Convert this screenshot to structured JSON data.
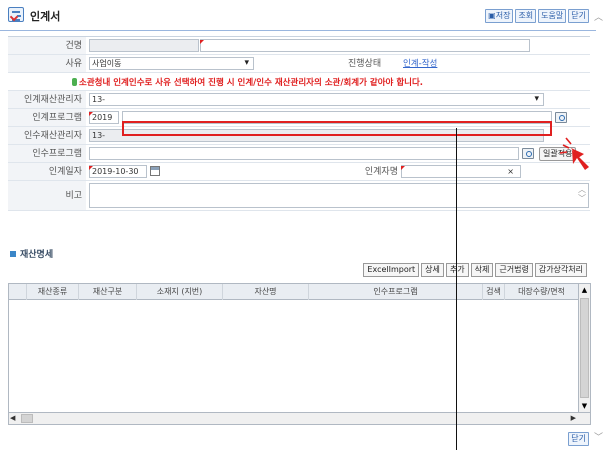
{
  "window": {
    "title": "인계서",
    "buttons": [
      {
        "label": "▣저장"
      },
      {
        "label": "조회"
      },
      {
        "label": "도움말"
      },
      {
        "label": "닫기"
      }
    ]
  },
  "form": {
    "name_label": "건명",
    "name_value": "",
    "reason_label": "사유",
    "reason_value": "사업이동",
    "status_label": "진행상태",
    "status_value": "인계-작성",
    "warning": "소관청내 인계인수로 사유 선택하여 진행 시 인계/인수 재산관리자의 소관/회계가 같아야 합니다.",
    "handover_manager_label": "인계재산관리자",
    "handover_manager_value": "13-",
    "handover_program_label": "인계프로그램",
    "handover_program_year": "2019",
    "handover_program_value": "",
    "takeover_manager_label": "인수재산관리자",
    "takeover_manager_value": "13-",
    "takeover_program_label": "인수프로그램",
    "takeover_program_value": "",
    "batch_apply_label": "일괄적용",
    "handover_date_label": "인계일자",
    "handover_date_value": "2019-10-30",
    "handover_person_label": "인계자명",
    "handover_person_value": "",
    "clear_glyph": "×",
    "remarks_label": "비고",
    "remarks_value": ""
  },
  "details": {
    "section_title": "재산명세",
    "buttons": [
      {
        "label": "ExcelImport"
      },
      {
        "label": "상세"
      },
      {
        "label": "추가"
      },
      {
        "label": "삭제"
      },
      {
        "label": "근거법령"
      },
      {
        "label": "감가상각처리"
      }
    ],
    "columns": [
      "재산종류",
      "재산구분",
      "소재지 (지번)",
      "자산명",
      "인수프로그램",
      "검색",
      "대장수량/면적"
    ],
    "rows": []
  },
  "footer": {
    "close_label": "닫기"
  },
  "icons": {
    "title": "checklist-icon",
    "calendar": "calendar-icon",
    "search": "search-icon"
  },
  "colors": {
    "warning": "#e02020",
    "link": "#3366cc",
    "accent": "#3b86c8"
  }
}
